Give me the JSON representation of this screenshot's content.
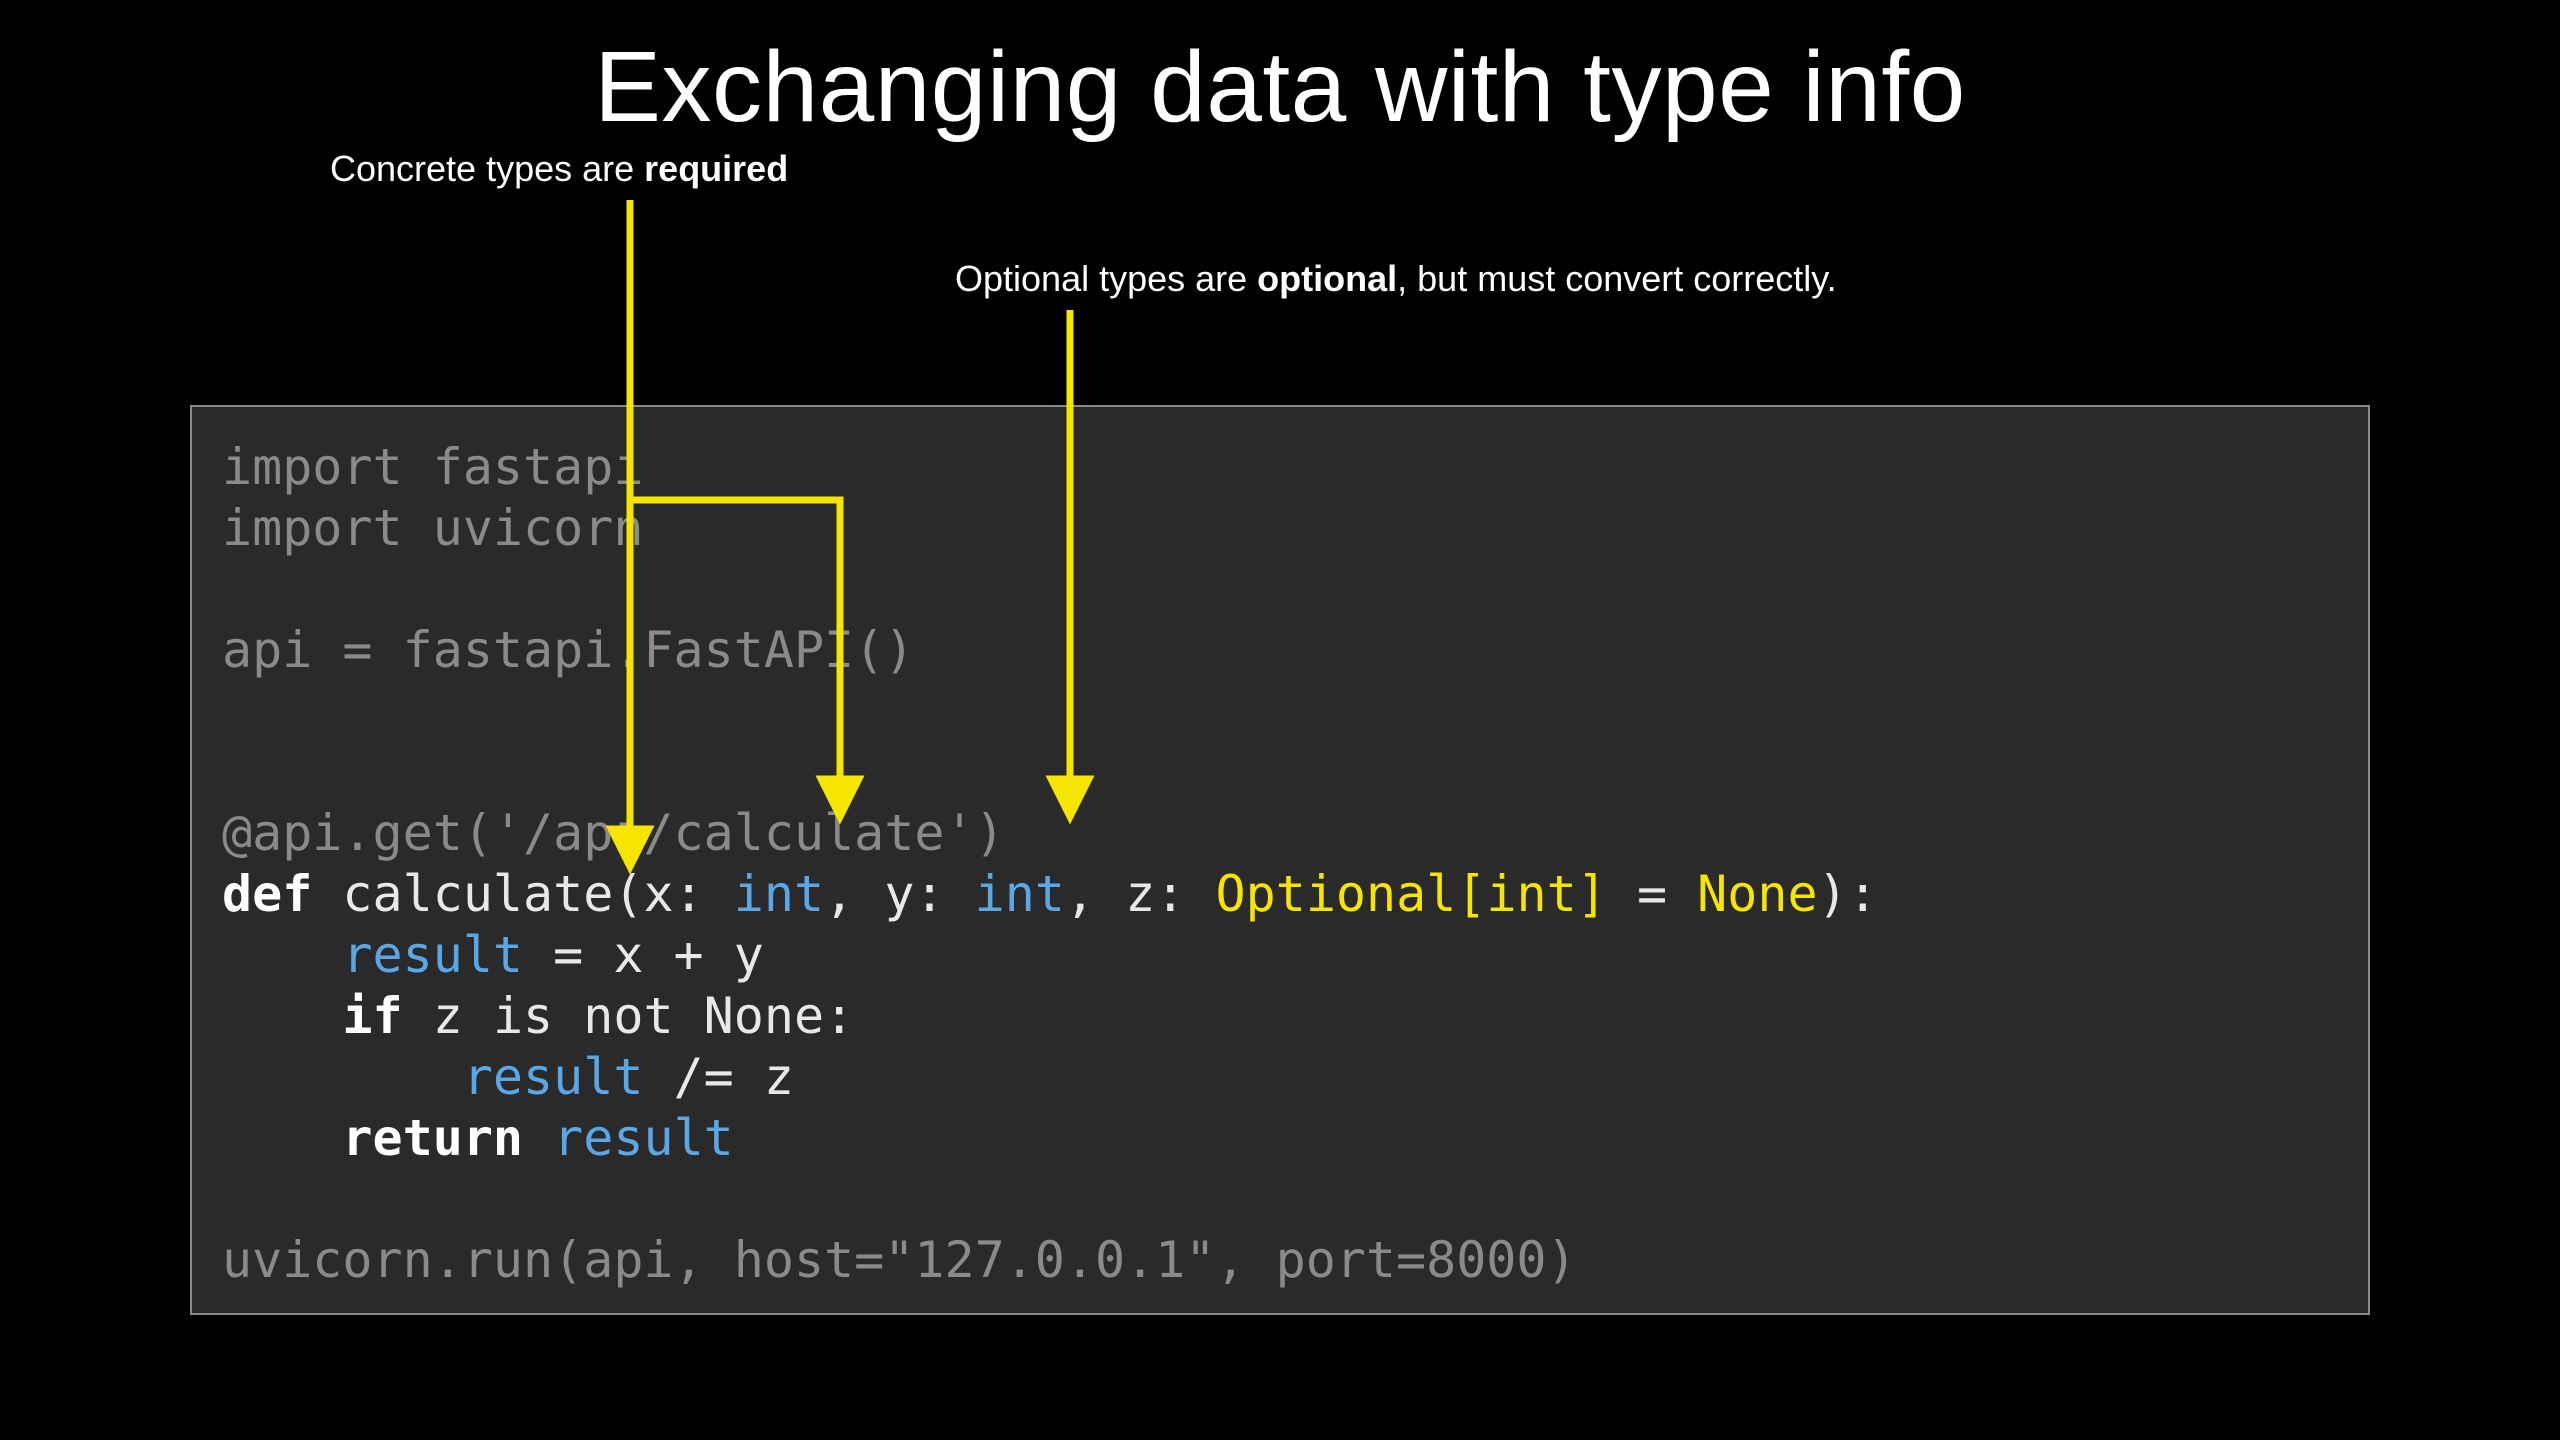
{
  "title": "Exchanging data with type info",
  "annotations": {
    "required_pre": "Concrete types are ",
    "required_bold": "required",
    "optional_pre": "Optional types are ",
    "optional_bold": "optional",
    "optional_post": ", but must convert correctly."
  },
  "code": {
    "line1": "import fastapi",
    "line2": "import uvicorn",
    "line3": "",
    "line4": "api = fastapi.FastAPI()",
    "line5": "",
    "line6": "",
    "line7": "@api.get('/api/calculate')",
    "line8_def": "def",
    "line8_space1": " ",
    "line8_fn": "calculate",
    "line8_open": "(",
    "line8_p1name": "x",
    "line8_p1colon": ": ",
    "line8_p1type": "int",
    "line8_sep1": ", ",
    "line8_p2name": "y",
    "line8_p2colon": ": ",
    "line8_p2type": "int",
    "line8_sep2": ", ",
    "line8_p3name": "z",
    "line8_p3colon": ": ",
    "line8_p3type": "Optional[int]",
    "line8_p3def": " = ",
    "line8_p3val": "None",
    "line8_close": "):",
    "line9_indent": "    ",
    "line9_var": "result",
    "line9_rest": " = x + y",
    "line10_indent": "    ",
    "line10_if": "if",
    "line10_rest": " z is not None:",
    "line11_indent": "        ",
    "line11_var": "result",
    "line11_rest": " /= z",
    "line12_indent": "    ",
    "line12_ret": "return",
    "line12_space": " ",
    "line12_var": "result",
    "line13": "",
    "line14": "uvicorn.run(api, host=\"127.0.0.1\", port=8000)"
  },
  "colors": {
    "arrow": "#f5e500"
  }
}
